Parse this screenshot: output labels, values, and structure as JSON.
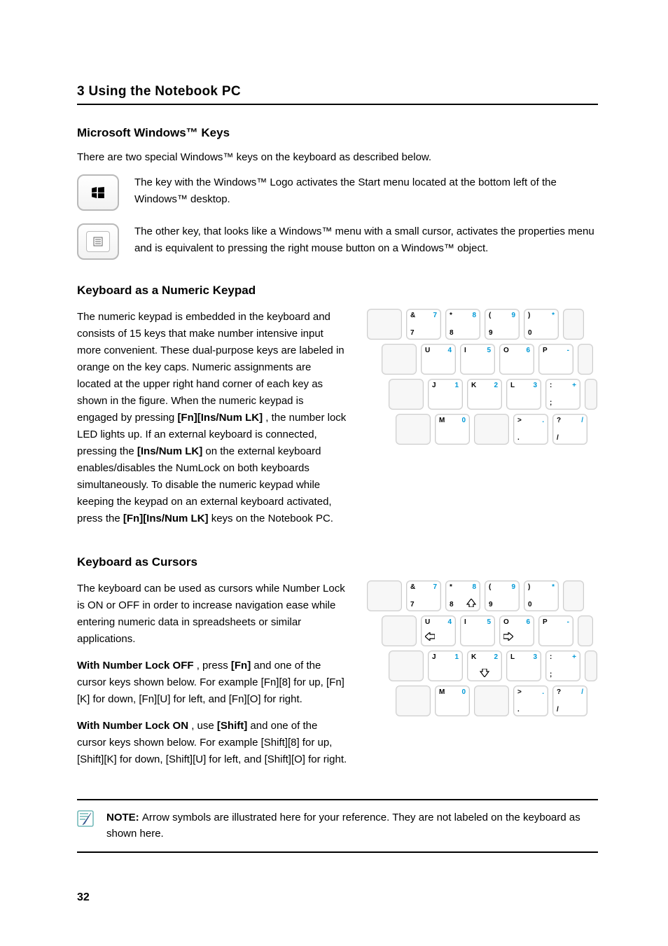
{
  "header": {
    "chapter": "3    Using the Notebook PC"
  },
  "ms_keys": {
    "title": "Microsoft Windows™ Keys",
    "intro": "There are two special Windows™ keys on the keyboard as described below.",
    "win_key_name": "windows-key-icon",
    "win_desc": "The key with the Windows™ Logo activates the Start menu located at the bottom left of the Windows™ desktop.",
    "menu_key_name": "context-menu-key-icon",
    "menu_desc": "The other key, that looks like a Windows™ menu with a small cursor, activates the properties menu and is equivalent to pressing the right mouse button on a Windows™ object."
  },
  "numeric": {
    "title": "Keyboard as a Numeric Keypad",
    "p1": "The numeric keypad is embedded in the keyboard and consists of 15 keys that make number intensive input more convenient. These dual-purpose keys are labeled in orange on the key caps. Numeric assignments are located at the upper right hand corner of each key as shown in the figure. When the numeric keypad is engaged by pressing ",
    "p1_key1": "[Fn][Ins/Num LK]",
    "p1_cont": ", the number lock LED lights up. If an external keyboard is connected, pressing the ",
    "p1_key2": "[Ins/Num LK]",
    "p1_cont2": " on the external keyboard enables/disables the NumLock on both keyboards simultaneously. To disable the numeric keypad while keeping the keypad on an external keyboard activated, press the ",
    "p1_key3": "[Fn][Ins/Num LK]",
    "p1_cont3": " keys on the Notebook PC."
  },
  "cursors": {
    "title": "Keyboard as Cursors",
    "p1": "The keyboard can be used as cursors while Number Lock is ON or OFF in order to increase navigation ease while entering numeric data in spreadsheets or similar applications.",
    "p2_pre": "With Number Lock OFF",
    "p2": ", press ",
    "p2_key": "[Fn]",
    "p2_cont": " and one of the cursor keys shown below. For example [Fn][8] for up, [Fn][K] for down, [Fn][U] for left, and [Fn][O] for right.",
    "p3_pre": "With Number Lock ON",
    "p3": ", use ",
    "p3_key": "[Shift]",
    "p3_cont": " and one of the cursor keys shown below. For example [Shift][8] for up, [Shift][K] for down, [Shift][U] for left, and [Shift][O] for right."
  },
  "note": {
    "text": "Arrow symbols are illustrated here for your reference. They are not labeled on the keyboard as shown here."
  },
  "keys_numpad": {
    "r1": [
      {
        "tl": "&",
        "tr": "7",
        "bl": "7"
      },
      {
        "tl": "*",
        "tr": "8",
        "bl": "8"
      },
      {
        "tl": "(",
        "tr": "9",
        "bl": "9"
      },
      {
        "tl": ")",
        "tr": "*",
        "bl": "0"
      }
    ],
    "r2": [
      {
        "tl": "U",
        "tr": "4",
        "bl": ""
      },
      {
        "tl": "I",
        "tr": "5",
        "bl": ""
      },
      {
        "tl": "O",
        "tr": "6",
        "bl": ""
      },
      {
        "tl": "P",
        "tr": "-",
        "bl": ""
      }
    ],
    "r3": [
      {
        "tl": "J",
        "tr": "1",
        "bl": ""
      },
      {
        "tl": "K",
        "tr": "2",
        "bl": ""
      },
      {
        "tl": "L",
        "tr": "3",
        "bl": ""
      },
      {
        "tl": ":",
        "tr": "+",
        "bl": ";"
      }
    ],
    "r4": [
      {
        "tl": "M",
        "tr": "0",
        "bl": ""
      },
      {
        "tl": ">",
        "tr": ".",
        "bl": "."
      },
      {
        "tl": "?",
        "tr": "/",
        "bl": "/"
      }
    ]
  },
  "pagenum": "32"
}
